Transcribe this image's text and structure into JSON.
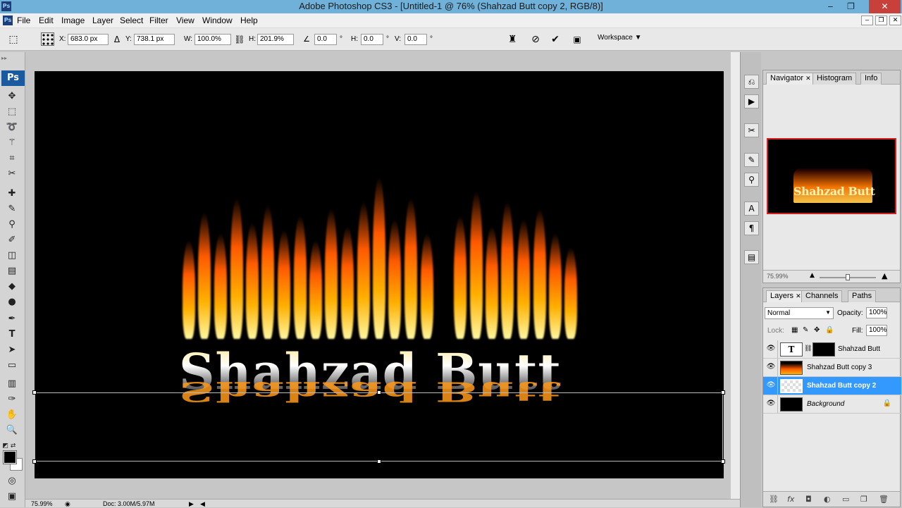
{
  "window": {
    "title": "Adobe Photoshop CS3 - [Untitled-1 @ 76% (Shahzad Butt copy 2, RGB/8)]"
  },
  "menu": [
    "File",
    "Edit",
    "Image",
    "Layer",
    "Select",
    "Filter",
    "View",
    "Window",
    "Help"
  ],
  "options": {
    "x_label": "X:",
    "x_value": "683.0 px",
    "y_label": "Y:",
    "y_value": "738.1 px",
    "w_label": "W:",
    "w_value": "100.0%",
    "h_label": "H:",
    "h_value": "201.9%",
    "rot_value": "0.0",
    "deg1": "°",
    "hskew_label": "H:",
    "hskew_value": "0.0",
    "deg2": "°",
    "vskew_label": "V:",
    "vskew_value": "0.0",
    "deg3": "°",
    "workspace_label": "Workspace ▼"
  },
  "toolbar": {
    "ps_logo": "Ps"
  },
  "canvas": {
    "text": "Shahzad Butt"
  },
  "status": {
    "zoom": "75.99%",
    "doc": "Doc: 3.00M/5.97M"
  },
  "navigator": {
    "tabs": [
      "Navigator",
      "Histogram",
      "Info"
    ],
    "zoom": "75.99%",
    "thumb_text": "Shahzad Butt",
    "zoom_level": 0.5
  },
  "layers": {
    "tabs": [
      "Layers",
      "Channels",
      "Paths"
    ],
    "blend_mode": "Normal",
    "opacity_label": "Opacity:",
    "opacity": "100%",
    "lock_label": "Lock:",
    "fill_label": "Fill:",
    "fill": "100%",
    "items": [
      {
        "name": "Shahzad Butt"
      },
      {
        "name": "Shahzad Butt copy 3"
      },
      {
        "name": "Shahzad Butt copy 2"
      },
      {
        "name": "Background"
      }
    ]
  },
  "colors": {
    "title_bar": "#6fb1d9",
    "selection": "#3399ff",
    "close": "#c7413a"
  }
}
